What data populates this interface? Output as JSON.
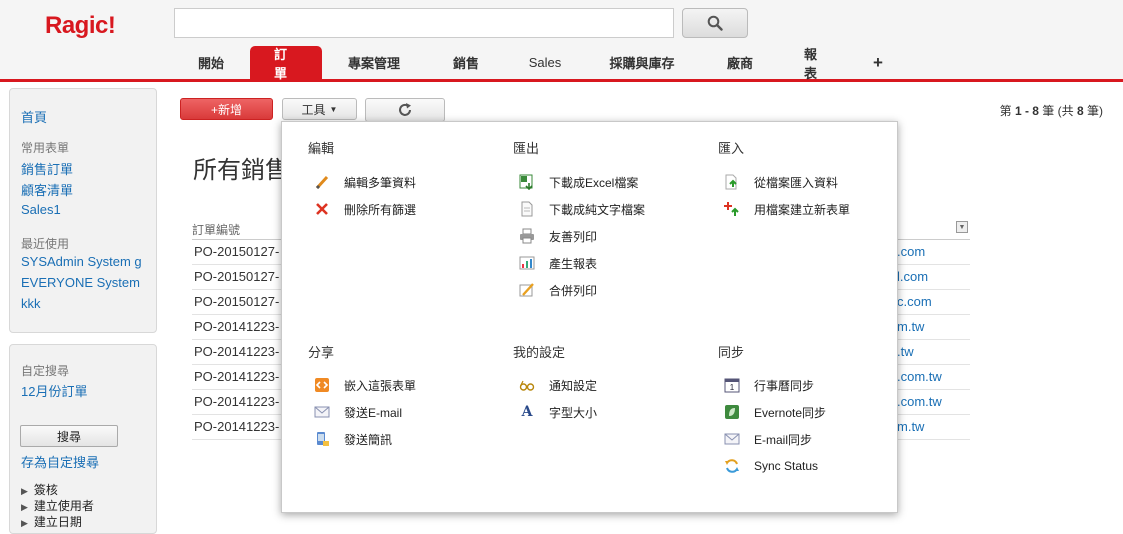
{
  "app": {
    "logo": "Ragic!"
  },
  "nav": {
    "tabs": [
      {
        "label": "開始"
      },
      {
        "label": "訂單"
      },
      {
        "label": "專案管理"
      },
      {
        "label": "銷售"
      },
      {
        "label": "Sales"
      },
      {
        "label": "採購與庫存"
      },
      {
        "label": "廠商"
      },
      {
        "label": "報表"
      },
      {
        "label": "+"
      }
    ]
  },
  "sidebar": {
    "home": "首頁",
    "common_label": "常用表單",
    "common": [
      "銷售訂單",
      "顧客清單",
      "Sales1"
    ],
    "recent_label": "最近使用",
    "recent": [
      "SYSAdmin System g",
      "EVERYONE System",
      "kkk"
    ],
    "custom_label": "自定搜尋",
    "custom": [
      "12月份訂單"
    ],
    "search_button": "搜尋",
    "save_search": "存為自定搜尋",
    "tree": [
      "簽核",
      "建立使用者",
      "建立日期"
    ]
  },
  "toolbar": {
    "new_label": "+新增",
    "tools_label": "工具",
    "pager_prefix": "第 ",
    "pager_range": "1 - 8",
    "pager_mid": " 筆 (共 ",
    "pager_total": "8",
    "pager_suffix": " 筆)"
  },
  "page": {
    "title": "所有銷售"
  },
  "table": {
    "col1_header": "訂單編號",
    "rows": [
      {
        "c1": "PO-20150127-",
        "c2": ".com"
      },
      {
        "c1": "PO-20150127-",
        "c2": "l.com"
      },
      {
        "c1": "PO-20150127-",
        "c2": "c.com"
      },
      {
        "c1": "PO-20141223-",
        "c2": "m.tw"
      },
      {
        "c1": "PO-20141223-",
        "c2": ".tw"
      },
      {
        "c1": "PO-20141223-",
        "c2": ".com.tw"
      },
      {
        "c1": "PO-20141223-",
        "c2": ".com.tw"
      },
      {
        "c1": "PO-20141223-",
        "c2": "m.tw"
      }
    ]
  },
  "menu": {
    "edit": {
      "title": "編輯",
      "items": [
        "編輯多筆資料",
        "刪除所有篩選"
      ]
    },
    "export": {
      "title": "匯出",
      "items": [
        "下載成Excel檔案",
        "下載成純文字檔案",
        "友善列印",
        "產生報表",
        "合併列印"
      ]
    },
    "import": {
      "title": "匯入",
      "items": [
        "從檔案匯入資料",
        "用檔案建立新表單"
      ]
    },
    "share": {
      "title": "分享",
      "items": [
        "嵌入這張表單",
        "發送E-mail",
        "發送簡訊"
      ]
    },
    "settings": {
      "title": "我的設定",
      "items": [
        "通知設定",
        "字型大小"
      ]
    },
    "sync": {
      "title": "同步",
      "items": [
        "行事曆同步",
        "Evernote同步",
        "E-mail同步",
        "Sync Status"
      ]
    }
  },
  "colors": {
    "brand": "#d8181f",
    "link": "#1a6fb5"
  }
}
